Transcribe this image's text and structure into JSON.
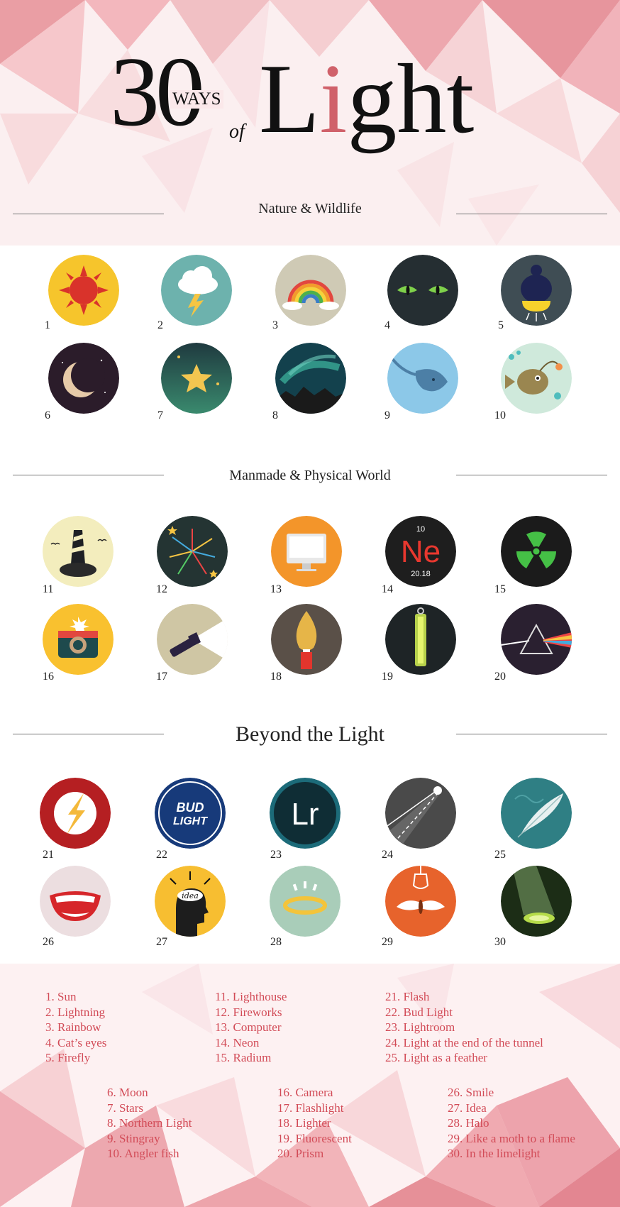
{
  "title": {
    "number": "30",
    "ways": "WAYS",
    "of": "of",
    "word_start": "L",
    "word_highlight": "i",
    "word_end": "ght"
  },
  "sections": [
    {
      "title": "Nature & Wildlife"
    },
    {
      "title": "Manmade & Physical World"
    },
    {
      "title": "Beyond the Light"
    }
  ],
  "icons": [
    {
      "num": "1",
      "name": "Sun"
    },
    {
      "num": "2",
      "name": "Lightning"
    },
    {
      "num": "3",
      "name": "Rainbow"
    },
    {
      "num": "4",
      "name": "Cat’s eyes"
    },
    {
      "num": "5",
      "name": "Firefly"
    },
    {
      "num": "6",
      "name": "Moon"
    },
    {
      "num": "7",
      "name": "Stars"
    },
    {
      "num": "8",
      "name": "Northern Light"
    },
    {
      "num": "9",
      "name": "Stingray"
    },
    {
      "num": "10",
      "name": "Angler fish"
    },
    {
      "num": "11",
      "name": "Lighthouse"
    },
    {
      "num": "12",
      "name": "Fireworks"
    },
    {
      "num": "13",
      "name": "Computer"
    },
    {
      "num": "14",
      "name": "Neon"
    },
    {
      "num": "15",
      "name": "Radium"
    },
    {
      "num": "16",
      "name": "Camera"
    },
    {
      "num": "17",
      "name": "Flashlight"
    },
    {
      "num": "18",
      "name": "Lighter"
    },
    {
      "num": "19",
      "name": "Fluorescent"
    },
    {
      "num": "20",
      "name": "Prism"
    },
    {
      "num": "21",
      "name": "Flash"
    },
    {
      "num": "22",
      "name": "Bud Light"
    },
    {
      "num": "23",
      "name": "Lightroom"
    },
    {
      "num": "24",
      "name": "Light at the end of the tunnel"
    },
    {
      "num": "25",
      "name": "Light as a feather"
    },
    {
      "num": "26",
      "name": "Smile"
    },
    {
      "num": "27",
      "name": "Idea"
    },
    {
      "num": "28",
      "name": "Halo"
    },
    {
      "num": "29",
      "name": "Like a moth to a flame"
    },
    {
      "num": "30",
      "name": "In the limelight"
    }
  ],
  "icon_text": {
    "neon_number": "10",
    "neon_symbol": "Ne",
    "neon_mass": "20.18",
    "bud_top": "BUD",
    "bud_bottom": "LIGHT",
    "lightroom": "Lr",
    "idea": "idea"
  },
  "legend": [
    [
      "1. Sun",
      "2. Lightning",
      "3. Rainbow",
      "4. Cat’s eyes",
      "5. Firefly"
    ],
    [
      "11. Lighthouse",
      "12. Fireworks",
      "13. Computer",
      "14. Neon",
      "15. Radium"
    ],
    [
      "21. Flash",
      "22. Bud Light",
      "23. Lightroom",
      "24. Light at the end of the tunnel",
      "25. Light as a feather"
    ],
    [
      "6. Moon",
      "7. Stars",
      "8. Northern Light",
      "9. Stingray",
      "10. Angler fish"
    ],
    [
      "16. Camera",
      "17. Flashlight",
      "18. Lighter",
      "19. Fluorescent",
      "20. Prism"
    ],
    [
      "26. Smile",
      "27. Idea",
      "28. Halo",
      "29. Like a moth to a flame",
      "30. In the limelight"
    ]
  ],
  "colors": {
    "accent": "#d0616a",
    "legend_text": "#d24b57",
    "rule": "#777777",
    "background_pink": "#f7d4d8"
  }
}
